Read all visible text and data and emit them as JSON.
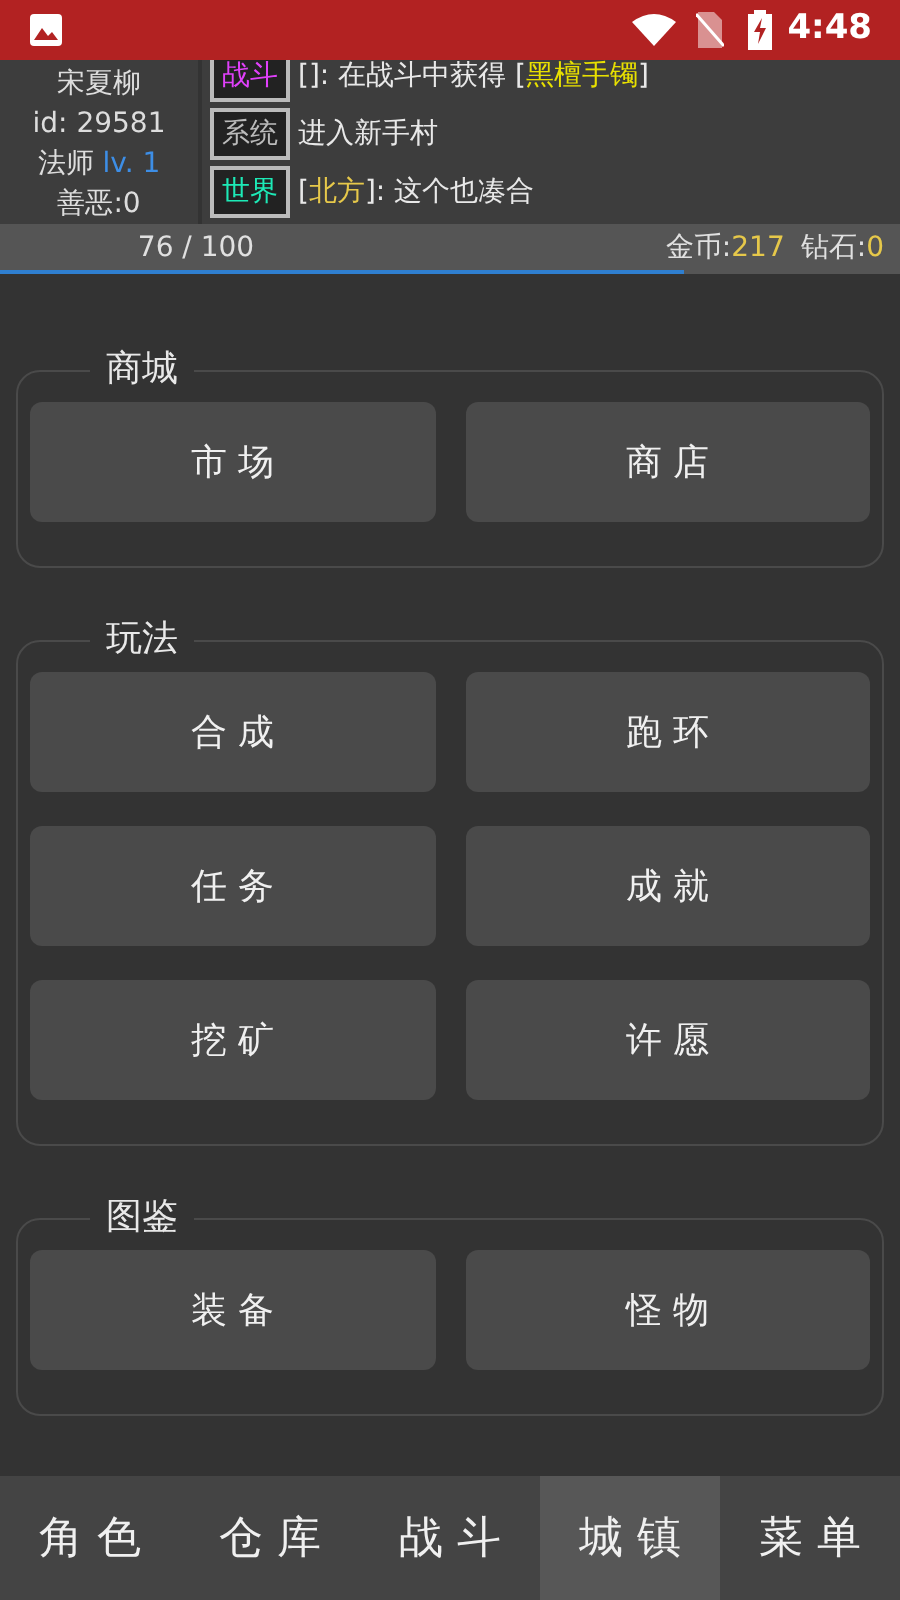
{
  "status_bar": {
    "time": "4:48"
  },
  "player": {
    "name": "宋夏柳",
    "id": "id: 29581",
    "class": "法师",
    "level": "lv. 1",
    "karma": "善恶:0"
  },
  "chat": [
    {
      "channel": "战斗",
      "color": "#e040fb",
      "parts": [
        {
          "kind": "plain",
          "text": "[]: 在战斗中获得 ["
        },
        {
          "kind": "item",
          "text": "黑檀手镯"
        },
        {
          "kind": "plain",
          "text": "]"
        }
      ]
    },
    {
      "channel": "系统",
      "color": "#bbbbbb",
      "parts": [
        {
          "kind": "plain",
          "text": "进入新手村"
        }
      ]
    },
    {
      "channel": "世界",
      "color": "#1de9b6",
      "parts": [
        {
          "kind": "plain",
          "text": "["
        },
        {
          "kind": "name",
          "text": "北方"
        },
        {
          "kind": "plain",
          "text": "]: 这个也凑合"
        }
      ]
    }
  ],
  "exp": {
    "reading": "76 / 100",
    "level": 0.76
  },
  "currency": [
    {
      "label": "金币:",
      "value": "217"
    },
    {
      "label": "钻石:",
      "value": "0"
    }
  ],
  "sections": [
    {
      "title": "商城",
      "buttons": [
        "市 场",
        "商 店"
      ]
    },
    {
      "title": "玩法",
      "buttons": [
        "合 成",
        "跑 环",
        "任 务",
        "成 就",
        "挖 矿",
        "许 愿"
      ]
    },
    {
      "title": "图鉴",
      "buttons": [
        "装 备",
        "怪 物"
      ]
    }
  ],
  "tabs": [
    {
      "label": "角 色",
      "selected": false
    },
    {
      "label": "仓 库",
      "selected": false
    },
    {
      "label": "战 斗",
      "selected": false
    },
    {
      "label": "城 镇",
      "selected": true
    },
    {
      "label": "菜 单",
      "selected": false
    }
  ]
}
